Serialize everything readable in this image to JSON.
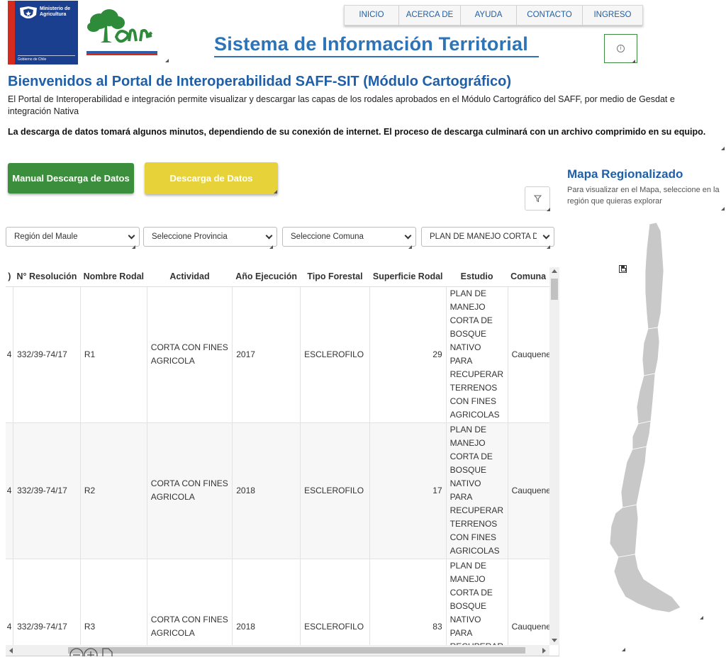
{
  "header": {
    "ministry_label": "Ministerio de Agricultura",
    "government_label": "Gobierno de Chile",
    "site_title": "Sistema de Información Territorial",
    "nav": [
      {
        "label": "INICIO"
      },
      {
        "label": "ACERCA DE"
      },
      {
        "label": "AYUDA"
      },
      {
        "label": "CONTACTO"
      },
      {
        "label": "INGRESO"
      }
    ],
    "info_icon": "info-icon"
  },
  "welcome": {
    "title": "Bienvenidos al Portal de Interoperabilidad SAFF-SIT (Módulo Cartográfico)",
    "intro": "El Portal de Interoperabilidad e integración permite visualizar y descargar las capas de los rodales aprobados en el Módulo Cartográfico del SAFF, por medio de Gesdat e integración Nativa",
    "download_note": "La descarga de datos tomará algunos minutos, dependiendo de su conexión de internet. El proceso de descarga culminará con un archivo comprimido en su equipo."
  },
  "buttons": {
    "manual": "Manual Descarga de Datos",
    "download": "Descarga de Datos",
    "filter_icon": "filter-icon"
  },
  "colors": {
    "primary_blue": "#1f5fa8",
    "title_blue": "#2d73b8",
    "manual_green": "#3b8e3c",
    "download_yellow": "#e7d339",
    "map_gray": "#c8c8c8"
  },
  "filters": {
    "region": "Región del Maule",
    "provincia": "Seleccione Provincia",
    "comuna": "Seleccione Comuna",
    "plan": "PLAN DE MANEJO CORTA D"
  },
  "map": {
    "title": "Mapa Regionalizado",
    "description": "Para visualizar en el Mapa, seleccione en la región que quieras explorar",
    "save_icon": "save-icon"
  },
  "table": {
    "columns": [
      ")",
      "N° Resolución",
      "Nombre Rodal",
      "Actividad",
      "Año Ejecución",
      "Tipo Forestal",
      "Superficie Rodal",
      "Estudio",
      "Comuna"
    ],
    "rows": [
      {
        "c0": "4",
        "resolucion": "332/39-74/17",
        "rodal": "R1",
        "actividad": "CORTA CON FINES AGRICOLA",
        "anio": "2017",
        "tipo": "ESCLEROFILO",
        "superficie": "29",
        "estudio": "PLAN DE MANEJO CORTA DE BOSQUE NATIVO PARA RECUPERAR TERRENOS CON FINES AGRICOLAS",
        "comuna": "Cauquenes"
      },
      {
        "c0": "4",
        "resolucion": "332/39-74/17",
        "rodal": "R2",
        "actividad": "CORTA CON FINES AGRICOLA",
        "anio": "2018",
        "tipo": "ESCLEROFILO",
        "superficie": "17",
        "estudio": "PLAN DE MANEJO CORTA DE BOSQUE NATIVO PARA RECUPERAR TERRENOS CON FINES AGRICOLAS",
        "comuna": "Cauquenes"
      },
      {
        "c0": "4",
        "resolucion": "332/39-74/17",
        "rodal": "R3",
        "actividad": "CORTA CON FINES AGRICOLA",
        "anio": "2018",
        "tipo": "ESCLEROFILO",
        "superficie": "83",
        "estudio": "PLAN DE MANEJO CORTA DE BOSQUE NATIVO PARA RECUPERAR TERRENOS CON FINES AGRICOLAS",
        "comuna": "Cauquenes"
      }
    ]
  }
}
